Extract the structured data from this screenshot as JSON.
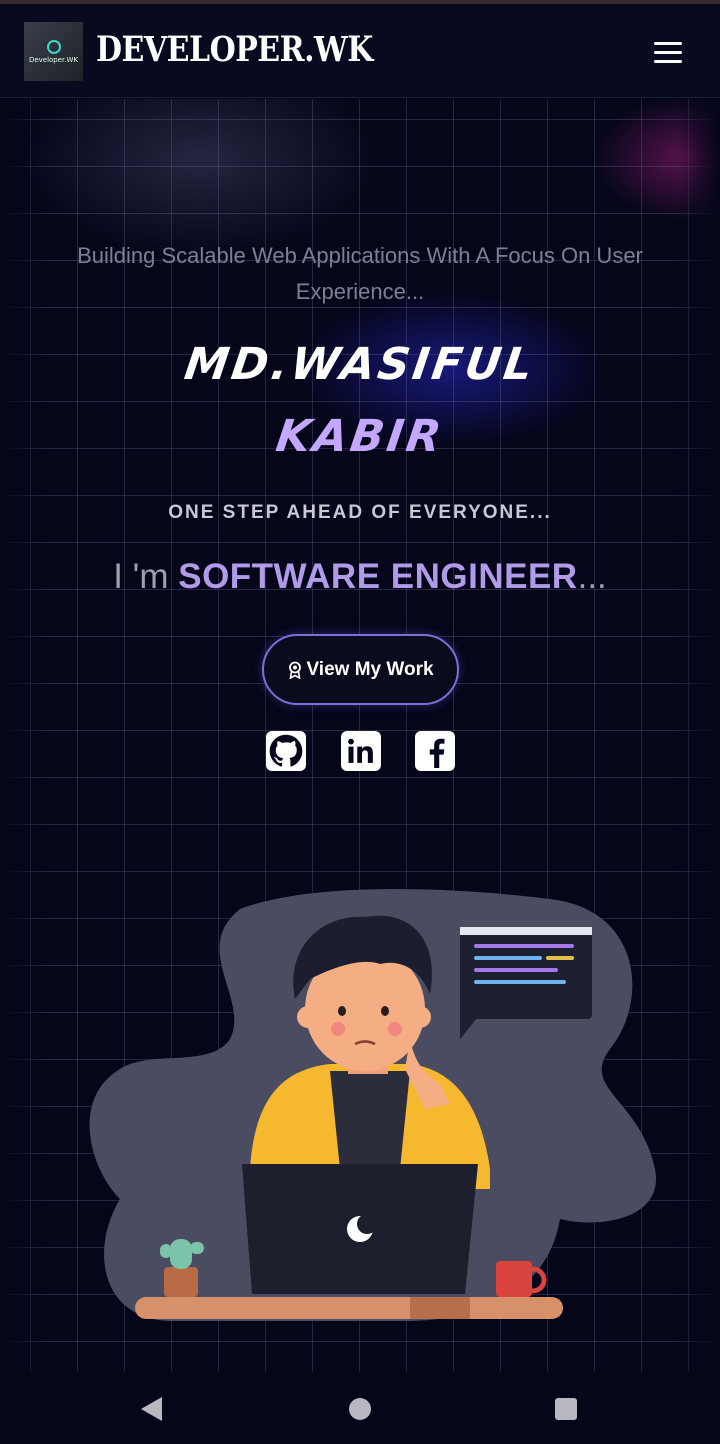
{
  "header": {
    "logo_text": "Developer.WK",
    "brand": "DEVELOPER.WK",
    "menu_icon": "hamburger-icon"
  },
  "hero": {
    "tagline": "Building Scalable Web Applications With A Focus On User Experience...",
    "name_line1": "MD.WASIFUL",
    "name_line2": "KABIR",
    "motto": "ONE STEP AHEAD OF EVERYONE...",
    "role_prefix": "I 'm ",
    "role": "SOFTWARE ENGINEER",
    "role_suffix": "...",
    "cta_label": "View My Work",
    "cta_icon": "award-icon",
    "socials": [
      {
        "name": "github-icon"
      },
      {
        "name": "linkedin-icon"
      },
      {
        "name": "facebook-icon"
      }
    ]
  },
  "colors": {
    "background": "#05061a",
    "accent": "#c4a8ff",
    "button_border": "#7d6fd8"
  },
  "system_nav": {
    "back": "back-icon",
    "home": "home-icon",
    "recents": "recents-icon"
  }
}
